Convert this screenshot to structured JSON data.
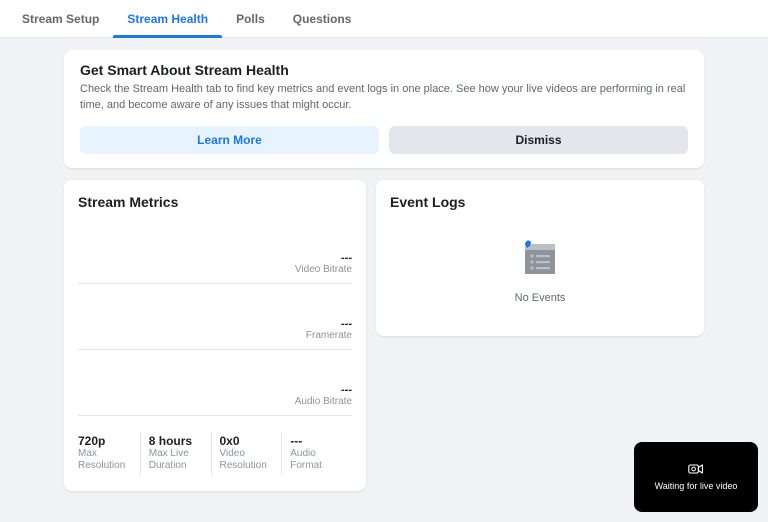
{
  "tabs": [
    {
      "label": "Stream Setup",
      "active": false
    },
    {
      "label": "Stream Health",
      "active": true
    },
    {
      "label": "Polls",
      "active": false
    },
    {
      "label": "Questions",
      "active": false
    }
  ],
  "banner": {
    "title": "Get Smart About Stream Health",
    "text": "Check the Stream Health tab to find key metrics and event logs in one place. See how your live videos are performing in real time, and become aware of any issues that might occur.",
    "learn_more": "Learn More",
    "dismiss": "Dismiss"
  },
  "metrics": {
    "title": "Stream Metrics",
    "charts": [
      {
        "value": "---",
        "label": "Video Bitrate"
      },
      {
        "value": "---",
        "label": "Framerate"
      },
      {
        "value": "---",
        "label": "Audio Bitrate"
      }
    ],
    "stats": [
      {
        "value": "720p",
        "label": "Max Resolution"
      },
      {
        "value": "8 hours",
        "label": "Max Live Duration"
      },
      {
        "value": "0x0",
        "label": "Video Resolution"
      },
      {
        "value": "---",
        "label": "Audio Format"
      }
    ]
  },
  "logs": {
    "title": "Event Logs",
    "empty": "No Events"
  },
  "preview": {
    "status": "Waiting for live video"
  }
}
